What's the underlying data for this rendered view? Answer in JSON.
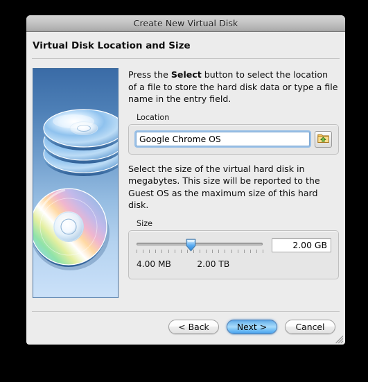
{
  "window": {
    "title": "Create New Virtual Disk",
    "heading": "Virtual Disk Location and Size"
  },
  "location_section": {
    "intro_before": "Press the ",
    "intro_bold": "Select",
    "intro_after": " button to select the location of a file to store the hard disk data or type a file name in the entry field.",
    "group_label": "Location",
    "input_value": "Google Chrome OS",
    "input_placeholder": "",
    "browse_icon": "folder-up-icon"
  },
  "size_section": {
    "description": "Select the size of the virtual hard disk in megabytes. This size will be reported to the Guest OS as the maximum size of this hard disk.",
    "group_label": "Size",
    "slider": {
      "min_label": "4.00 MB",
      "max_label": "2.00 TB",
      "thumb_percent": 43,
      "tick_count": 21
    },
    "value": "2.00 GB"
  },
  "buttons": {
    "back": "< Back",
    "next": "Next >",
    "cancel": "Cancel"
  },
  "colors": {
    "default_button_blue": "#79bdf0",
    "focus_ring_blue": "#6eaae6",
    "art_panel_top": "#3a6ba6",
    "art_panel_bottom": "#cbe1f8",
    "window_background": "#ececec"
  }
}
